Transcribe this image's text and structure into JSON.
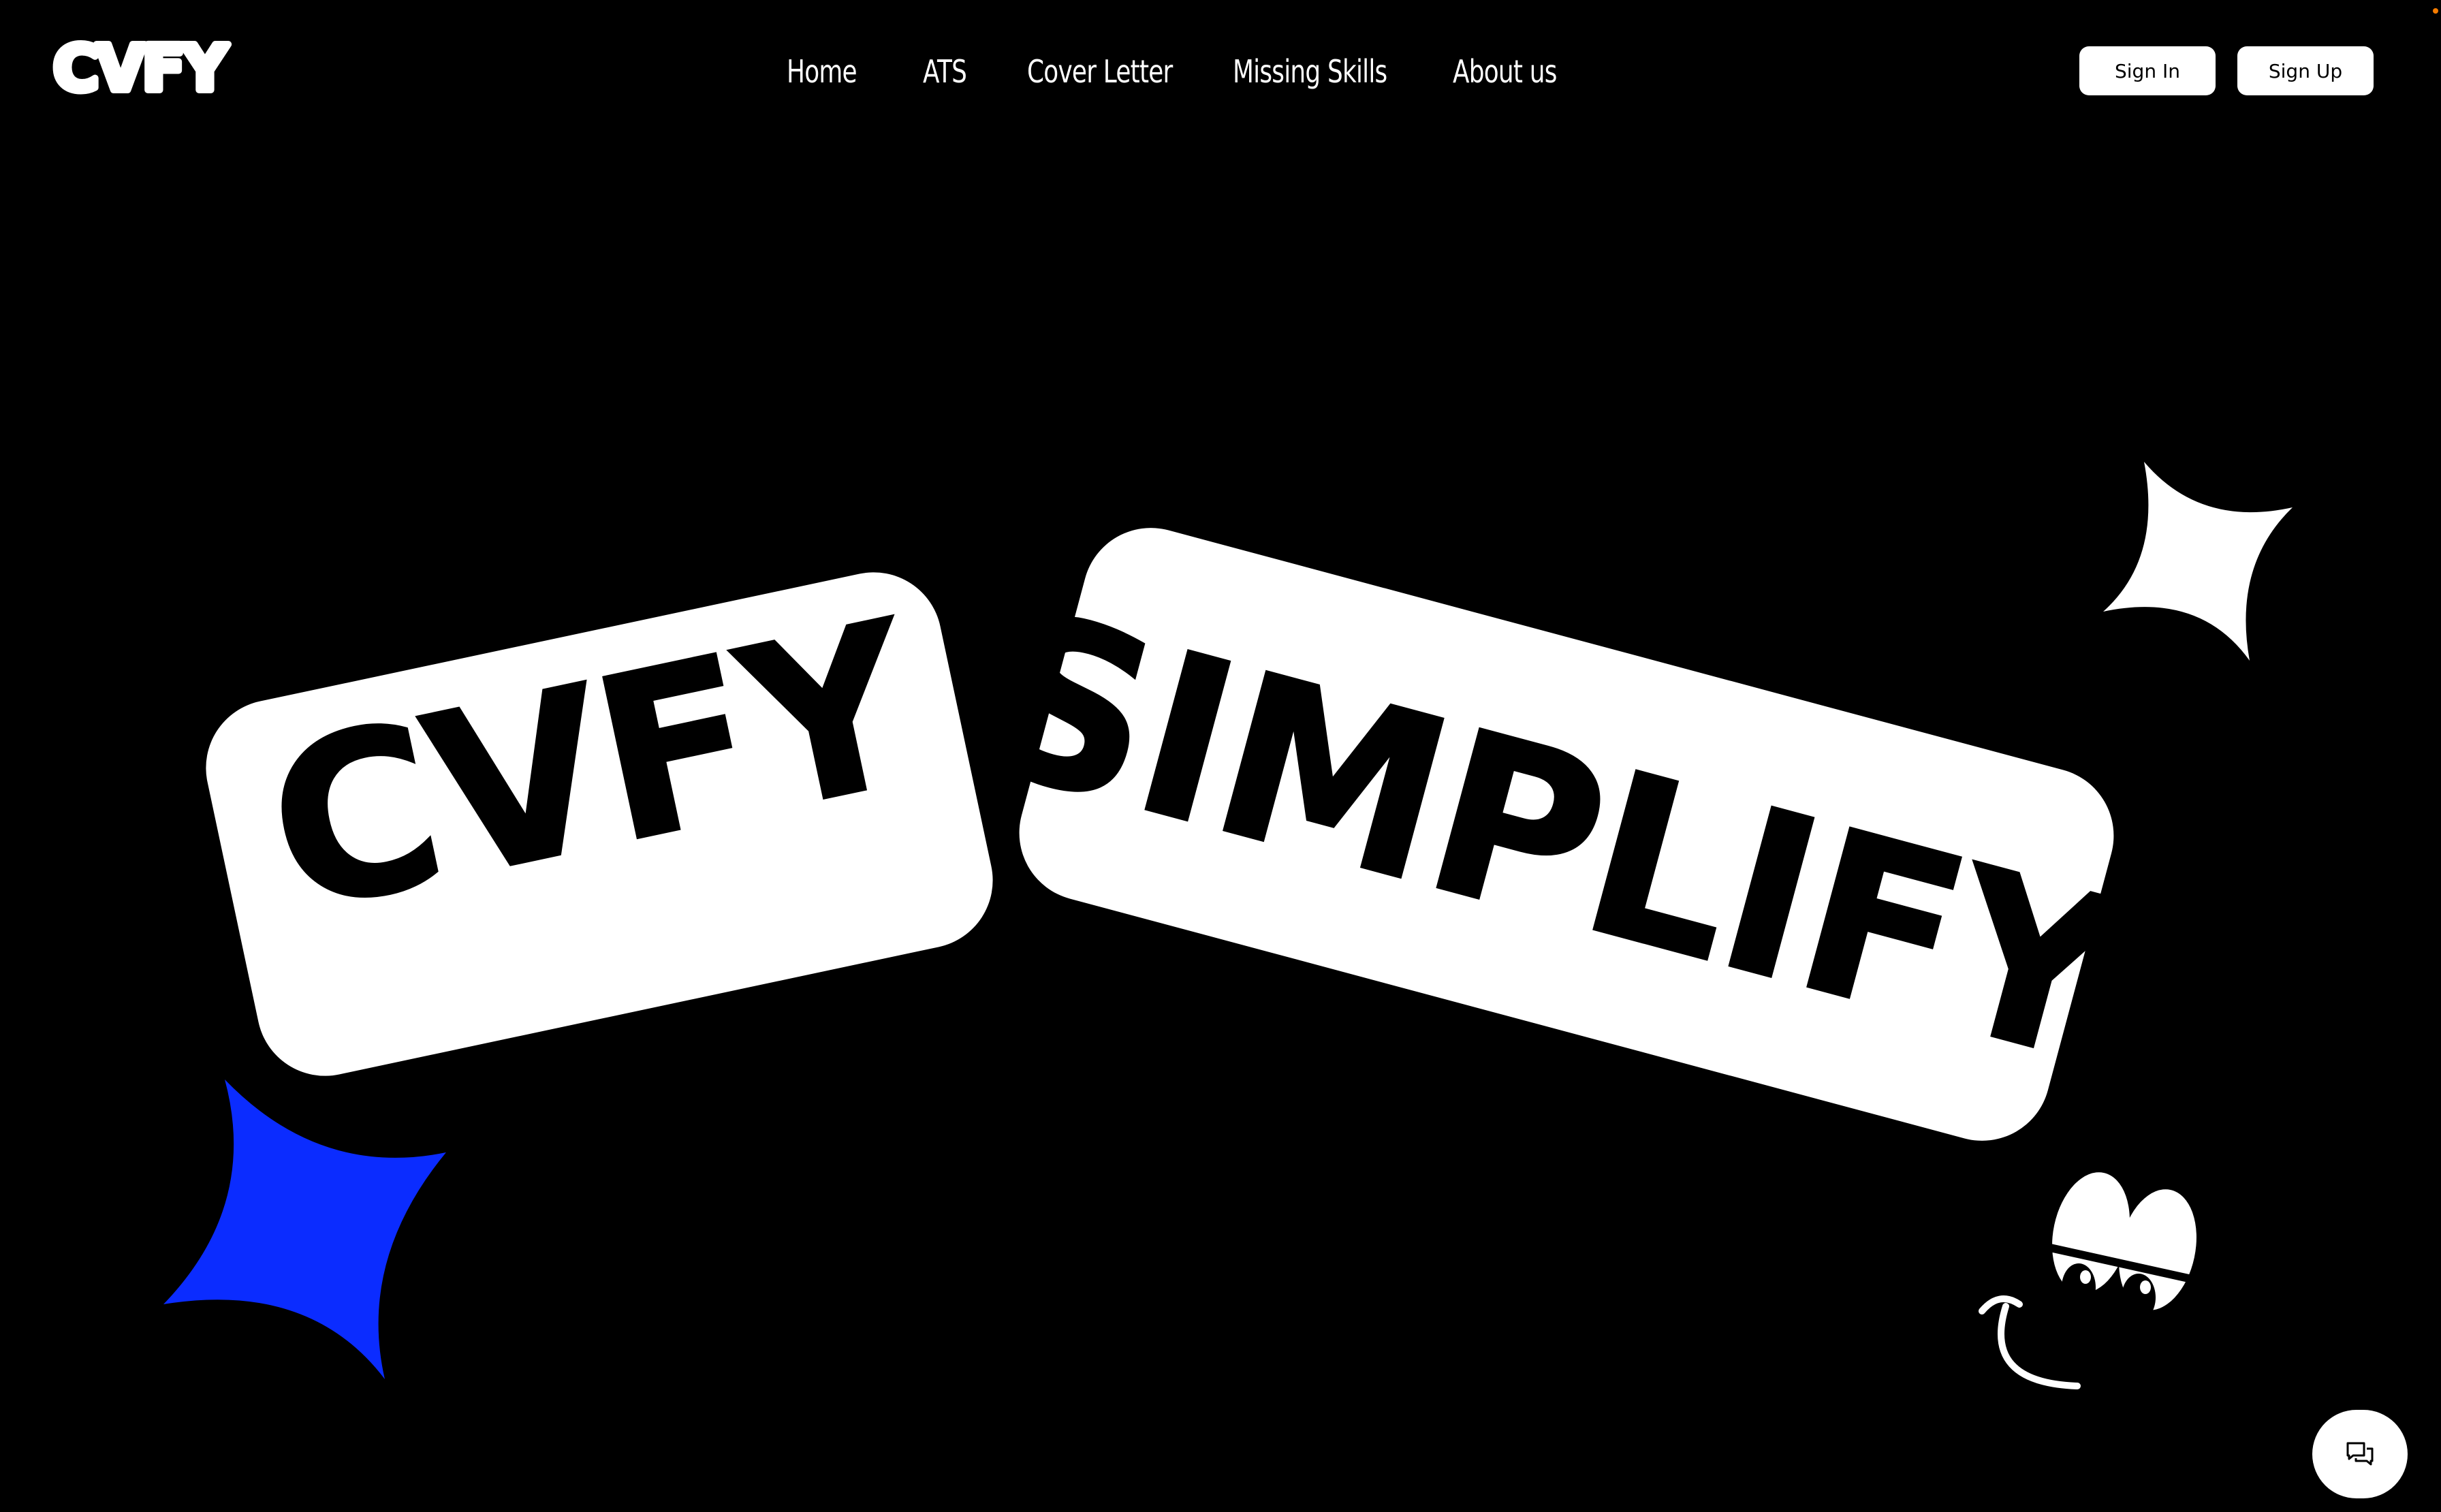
{
  "header": {
    "logo_text": "CVFY",
    "logo_icon": "cvfy-logo",
    "nav": [
      {
        "label": "Home"
      },
      {
        "label": "ATS"
      },
      {
        "label": "Cover Letter"
      },
      {
        "label": "Missing Skills"
      },
      {
        "label": "About us"
      }
    ],
    "sign_in_label": "Sign In",
    "sign_up_label": "Sign Up"
  },
  "hero": {
    "word_left": "CVFY",
    "word_right": "SIMPLIFY",
    "sparkle_white_icon": "sparkle-icon",
    "sparkle_blue_icon": "sparkle-icon",
    "face_icon": "cartoon-eyes-smile-icon"
  },
  "chat": {
    "icon": "chat-bubbles-icon"
  },
  "colors": {
    "background": "#000000",
    "foreground": "#ffffff",
    "accent_blue": "#0b2cff",
    "status_dot": "#f57c00"
  }
}
